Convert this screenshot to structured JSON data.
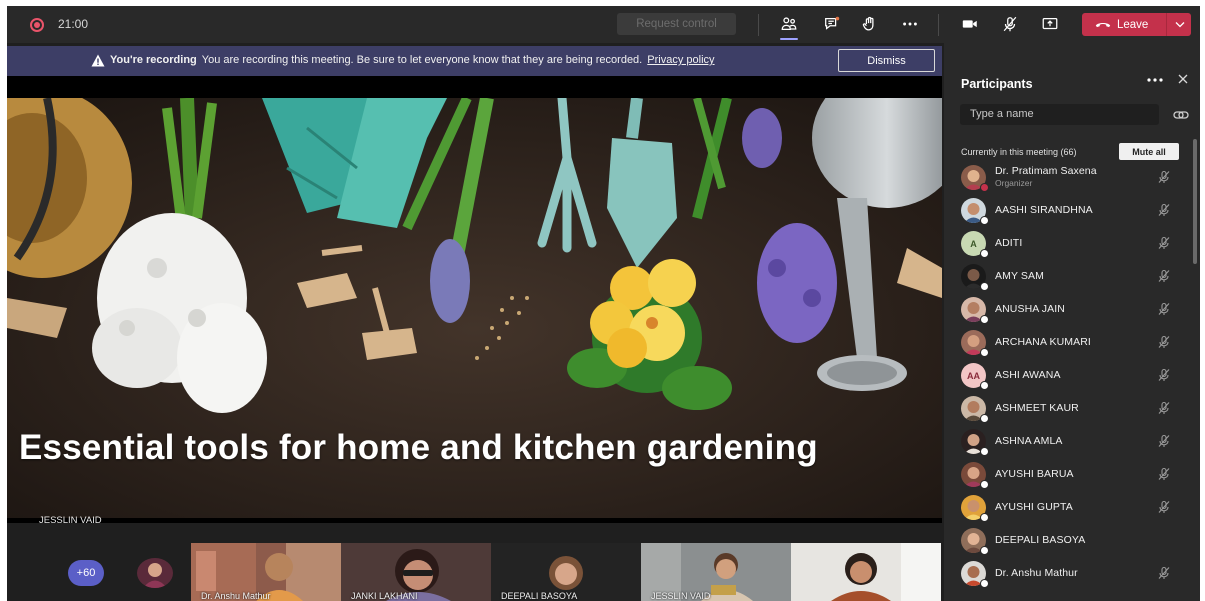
{
  "topbar": {
    "timer": "21:00",
    "request_control_label": "Request control",
    "leave_label": "Leave"
  },
  "banner": {
    "title": "You're recording",
    "message": "You are recording this meeting. Be sure to let everyone know that they are being recorded.",
    "link": "Privacy policy",
    "dismiss_label": "Dismiss"
  },
  "stage": {
    "slide_title": "Essential tools for home and kitchen gardening",
    "presenter_name": "JESSLIN VAID"
  },
  "strip": {
    "more_count": "+60",
    "thumbnails": [
      {
        "name": "Dr. Anshu Mathur"
      },
      {
        "name": "JANKI LAKHANI"
      },
      {
        "name": "DEEPALI BASOYA"
      },
      {
        "name": "JESSLIN VAID"
      },
      {
        "name": ""
      }
    ]
  },
  "panel": {
    "title": "Participants",
    "search_placeholder": "Type a name",
    "section_label": "Currently in this meeting (66)",
    "mute_all_label": "Mute all",
    "participants": [
      {
        "name": "Dr. Pratimam Saxena",
        "role": "Organizer",
        "initials": ""
      },
      {
        "name": "AASHI SIRANDHNA",
        "role": "",
        "initials": ""
      },
      {
        "name": "ADITI",
        "role": "",
        "initials": "A"
      },
      {
        "name": "AMY SAM",
        "role": "",
        "initials": ""
      },
      {
        "name": "ANUSHA JAIN",
        "role": "",
        "initials": ""
      },
      {
        "name": "ARCHANA KUMARI",
        "role": "",
        "initials": ""
      },
      {
        "name": "ASHI AWANA",
        "role": "",
        "initials": "AA"
      },
      {
        "name": "ASHMEET KAUR",
        "role": "",
        "initials": ""
      },
      {
        "name": "ASHNA AMLA",
        "role": "",
        "initials": ""
      },
      {
        "name": "AYUSHI BARUA",
        "role": "",
        "initials": ""
      },
      {
        "name": "AYUSHI GUPTA",
        "role": "",
        "initials": ""
      },
      {
        "name": "DEEPALI BASOYA",
        "role": "",
        "initials": ""
      },
      {
        "name": "Dr. Anshu Mathur",
        "role": "",
        "initials": ""
      }
    ]
  },
  "colors": {
    "leave": "#c4314b",
    "banner": "#3d3e66",
    "accent": "#5b5fc7",
    "panel": "#292929"
  },
  "icons": [
    "recording-icon",
    "participants-icon",
    "chat-icon",
    "raise-hand-icon",
    "more-icon",
    "camera-icon",
    "mic-off-icon",
    "share-screen-icon",
    "phone-icon",
    "chevron-down-icon",
    "warning-icon",
    "close-icon",
    "share-invite-icon"
  ]
}
